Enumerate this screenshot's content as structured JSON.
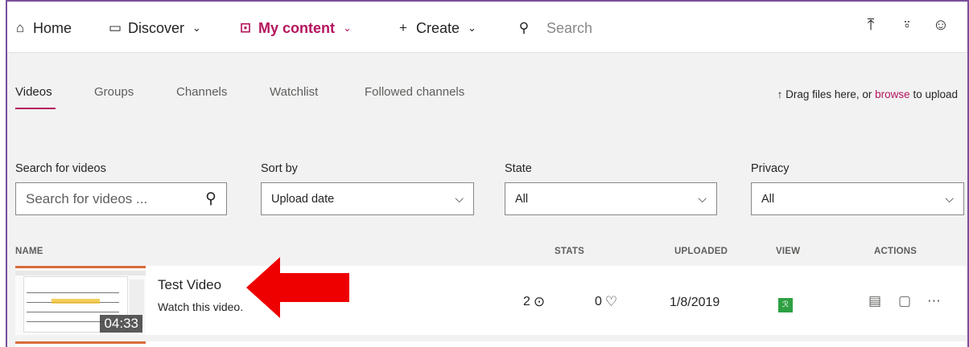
{
  "nav": {
    "home": "Home",
    "discover": "Discover",
    "my_content": "My content",
    "create": "Create",
    "search": "Search"
  },
  "tabs": [
    "Videos",
    "Groups",
    "Channels",
    "Watchlist",
    "Followed channels"
  ],
  "upload": {
    "prefix": "Drag files here, or ",
    "link": "browse",
    "suffix": " to upload"
  },
  "filters": {
    "search_label": "Search for videos",
    "search_placeholder": "Search for videos ...",
    "sort_label": "Sort by",
    "sort_value": "Upload date",
    "state_label": "State",
    "state_value": "All",
    "privacy_label": "Privacy",
    "privacy_value": "All"
  },
  "columns": {
    "name": "NAME",
    "stats": "STATS",
    "uploaded": "UPLOADED",
    "view": "VIEW",
    "actions": "ACTIONS"
  },
  "video": {
    "title": "Test Video",
    "description": "Watch this video.",
    "duration": "04:33",
    "views": "2",
    "likes": "0",
    "uploaded": "1/8/2019"
  },
  "colors": {
    "accent": "#b4145d",
    "frame": "#7a4f9c",
    "view_badge": "#2ea043",
    "arrow": "#ee0000"
  },
  "icons": {
    "home": "home-icon",
    "discover": "discover-icon",
    "my_content": "play-box-icon",
    "create": "plus-icon",
    "search": "search-icon",
    "upload": "upload-icon",
    "add_person": "add-person-icon",
    "feedback": "smiley-icon"
  }
}
